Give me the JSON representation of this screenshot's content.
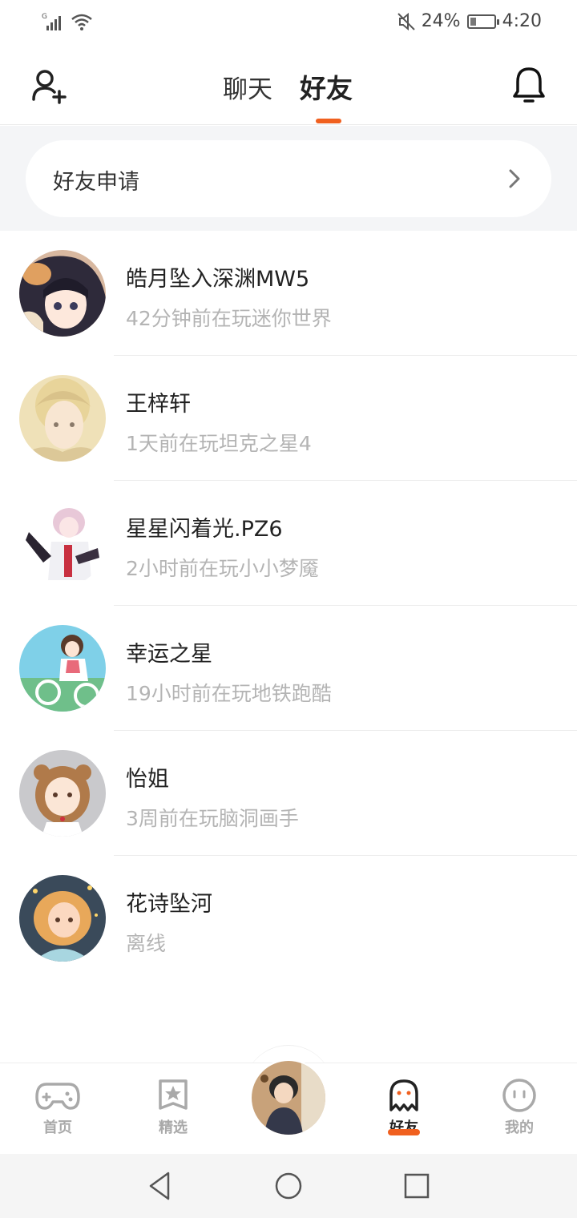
{
  "status_bar": {
    "signal_label": "G",
    "battery_percent": "24%",
    "battery_level": 0.24,
    "time": "4:20"
  },
  "header": {
    "tabs": [
      {
        "label": "聊天",
        "active": false
      },
      {
        "label": "好友",
        "active": true
      }
    ],
    "accent_color": "#f0601f"
  },
  "friend_requests": {
    "label": "好友申请"
  },
  "friends": [
    {
      "name": "皓月坠入深渊MW5",
      "status": "42分钟前在玩迷你世界"
    },
    {
      "name": "王梓轩",
      "status": "1天前在玩坦克之星4"
    },
    {
      "name": "星星闪着光.PZ6",
      "status": "2小时前在玩小小梦魇"
    },
    {
      "name": "幸运之星",
      "status": "19小时前在玩地铁跑酷"
    },
    {
      "name": "怡姐",
      "status": "3周前在玩脑洞画手"
    },
    {
      "name": "花诗坠河",
      "status": "离线"
    }
  ],
  "bottom_nav": {
    "items": [
      {
        "label": "首页",
        "icon": "gamepad-icon"
      },
      {
        "label": "精选",
        "icon": "star-badge-icon"
      },
      {
        "label": "好友",
        "icon": "ghost-icon",
        "active": true
      },
      {
        "label": "我的",
        "icon": "face-icon"
      }
    ]
  }
}
